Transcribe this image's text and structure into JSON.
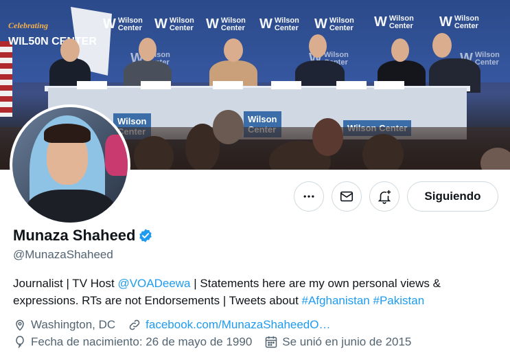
{
  "banner": {
    "celebrating_text": "Celebrating",
    "anniversary_text": "WIL50N CENTER",
    "logo_word_1": "Wilson",
    "logo_word_2": "Center"
  },
  "avatar": {
    "icon": "profile-photo"
  },
  "actions": {
    "more_icon": "more-icon",
    "message_icon": "mail-icon",
    "notify_icon": "bell-plus-icon",
    "follow_label": "Siguiendo"
  },
  "profile": {
    "name": "Munaza Shaheed",
    "verified": true,
    "handle": "@MunazaShaheed",
    "bio": {
      "part1": "Journalist | TV Host ",
      "mention": "@VOADeewa",
      "part2": " | Statements here are my own personal views & expressions. RTs are not Endorsements | Tweets about ",
      "hashtag1": "#Afghanistan",
      "space": " ",
      "hashtag2": "#Pakistan"
    },
    "location": "Washington, DC",
    "website": "facebook.com/MunazaShaheedO…",
    "birthday": "Fecha de nacimiento: 26 de mayo de 1990",
    "joined": "Se unió en junio de 2015"
  },
  "colors": {
    "accent": "#1d9bf0",
    "text_primary": "#0f1419",
    "text_secondary": "#536471",
    "border": "#cfd9de"
  }
}
